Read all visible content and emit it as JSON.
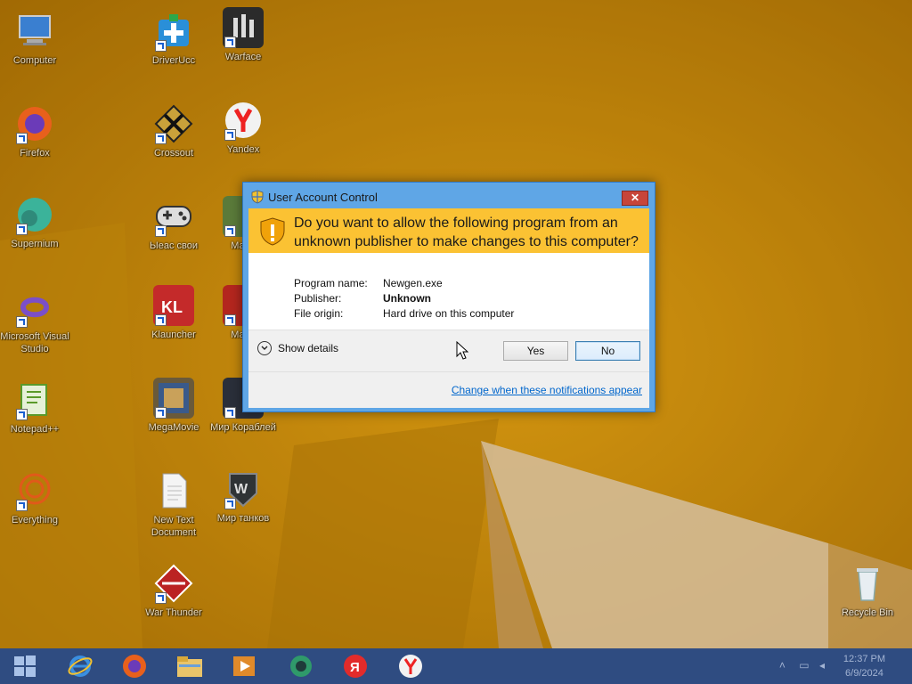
{
  "desktop": {
    "icons": [
      {
        "label": "Computer"
      },
      {
        "label": "DriverUcc"
      },
      {
        "label": "Warface"
      },
      {
        "label": "Firefox"
      },
      {
        "label": "Crossout"
      },
      {
        "label": "Yandex"
      },
      {
        "label": "Supernium"
      },
      {
        "label": "Ыеас свои"
      },
      {
        "label": "Майн"
      },
      {
        "label": "Microsoft Visual Studio"
      },
      {
        "label": "Klauncher"
      },
      {
        "label": "Майн"
      },
      {
        "label": "Notepad++"
      },
      {
        "label": "MegaMovie"
      },
      {
        "label": "Мир Кораблей"
      },
      {
        "label": "Everything"
      },
      {
        "label": "New Text Document"
      },
      {
        "label": "Мир танков"
      },
      {
        "label": "War Thunder"
      },
      {
        "label": "Recycle Bin"
      }
    ]
  },
  "taskbar": {
    "apps": [
      "start-icon",
      "internet-explorer-icon",
      "firefox-icon",
      "file-explorer-icon",
      "media-player-icon",
      "supernium-icon",
      "yandex-browser-icon",
      "yandex-icon"
    ],
    "tray_chevron": "˄",
    "clock_time": "12:37 PM",
    "clock_date": "6/9/2024"
  },
  "dialog": {
    "title": "User Account Control",
    "close_label": "✕",
    "question": "Do you want to allow the following program from an unknown publisher to make changes to this computer?",
    "program_name_key": "Program name:",
    "program_name_value": "Newgen.exe",
    "publisher_key": "Publisher:",
    "publisher_value": "Unknown",
    "file_origin_key": "File origin:",
    "file_origin_value": "Hard drive on this computer",
    "show_details_label": "Show details",
    "yes_label": "Yes",
    "no_label": "No",
    "change_link_label": "Change when these notifications appear"
  },
  "colors": {
    "wallpaper": "#c58a0a",
    "banner": "#fbc233",
    "dialog_frame": "#5fa6e6",
    "link": "#0066cc"
  }
}
